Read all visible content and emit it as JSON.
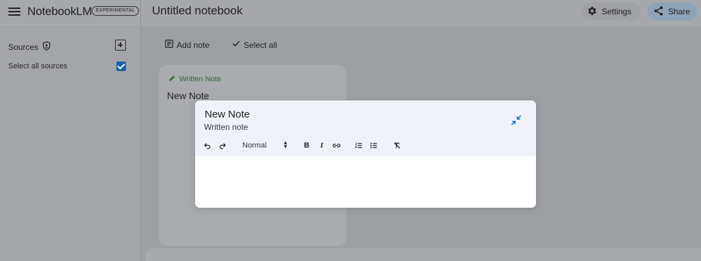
{
  "header": {
    "app_name": "NotebookLM",
    "badge": "EXPERIMENTAL",
    "notebook_title": "Untitled notebook",
    "settings_label": "Settings",
    "share_label": "Share"
  },
  "sidebar": {
    "sources_label": "Sources",
    "select_all_label": "Select all sources",
    "select_all_checked": true
  },
  "toolbar": {
    "add_note_label": "Add note",
    "select_all_label": "Select all"
  },
  "note_card": {
    "type_label": "Written Note",
    "title": "New Note"
  },
  "modal": {
    "title": "New Note",
    "subtitle": "Written note",
    "format_value": "Normal",
    "bold_label": "B",
    "italic_label": "I"
  },
  "colors": {
    "accent": "#1a73e8",
    "note_type_green": "#2e6b35"
  }
}
